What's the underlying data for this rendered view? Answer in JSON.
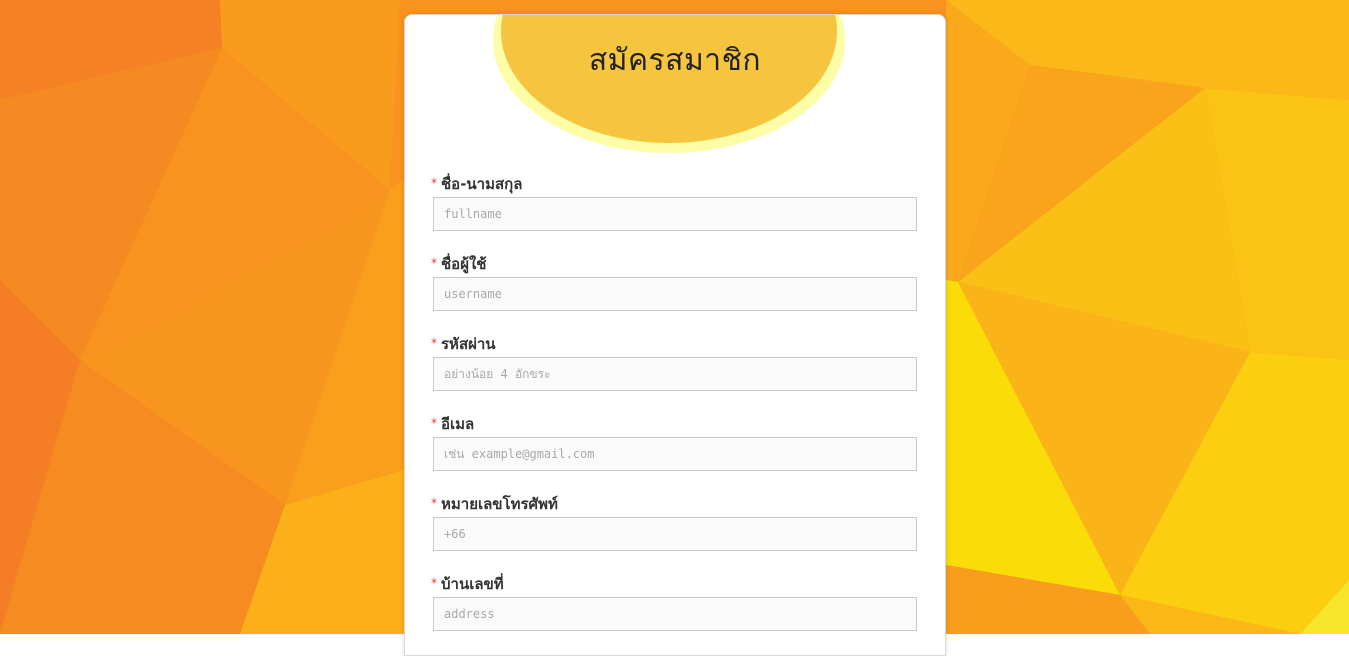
{
  "page": {
    "title": "สมัครสมาชิก",
    "colors": {
      "background_orange": "#f7931e",
      "background_yellow": "#f9d90a",
      "title_bubble": "#f5c540",
      "title_bubble_ring": "#fdfda8",
      "required_star": "#e53935"
    }
  },
  "form": {
    "required_marker": "*",
    "fields": [
      {
        "label": "ชื่อ-นามสกุล",
        "placeholder": "fullname",
        "value": ""
      },
      {
        "label": "ชื่อผู้ใช้",
        "placeholder": "username",
        "value": ""
      },
      {
        "label": "รหัสผ่าน",
        "placeholder": "อย่างน้อย 4 อักขระ",
        "value": ""
      },
      {
        "label": "อีเมล",
        "placeholder": "เช่น example@gmail.com",
        "value": ""
      },
      {
        "label": "หมายเลขโทรศัพท์",
        "placeholder": "+66",
        "value": ""
      },
      {
        "label": "บ้านเลขที่",
        "placeholder": "address",
        "value": ""
      }
    ]
  }
}
